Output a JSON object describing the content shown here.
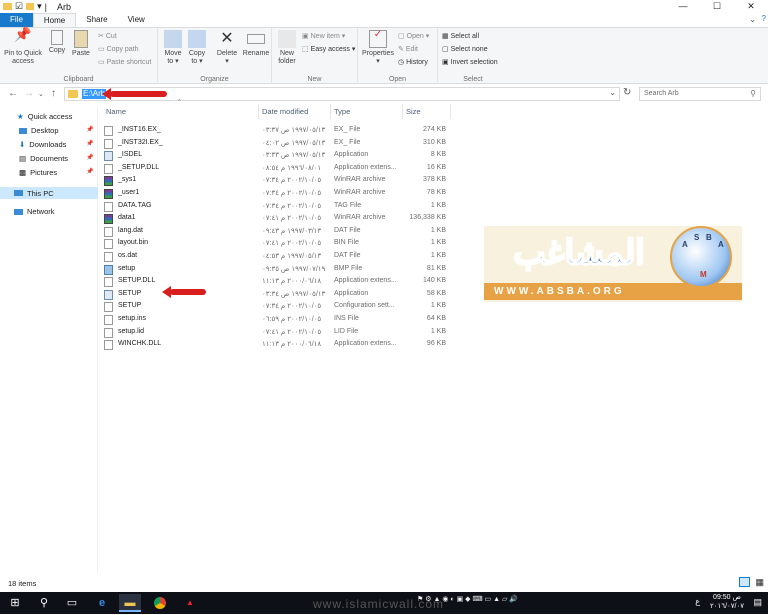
{
  "window": {
    "title": "Arb",
    "controls": {
      "minimize": "—",
      "maximize": "☐",
      "close": "✕"
    }
  },
  "tabs": [
    {
      "label": "File"
    },
    {
      "label": "Home"
    },
    {
      "label": "Share"
    },
    {
      "label": "View"
    }
  ],
  "ribbon": {
    "clipboard": {
      "group_label": "Clipboard",
      "pin_label_1": "Pin to Quick",
      "pin_label_2": "access",
      "copy": "Copy",
      "paste": "Paste",
      "cut": "Cut",
      "copy_path": "Copy path",
      "paste_shortcut": "Paste shortcut"
    },
    "organize": {
      "group_label": "Organize",
      "move_to_1": "Move",
      "move_to_2": "to ▾",
      "copy_to_1": "Copy",
      "copy_to_2": "to ▾",
      "delete_1": "Delete",
      "delete_2": "▾",
      "rename": "Rename"
    },
    "new": {
      "group_label": "New",
      "new_folder_1": "New",
      "new_folder_2": "folder",
      "new_item": "New item ▾",
      "easy_access": "Easy access ▾"
    },
    "open": {
      "group_label": "Open",
      "properties_1": "Properties",
      "properties_2": "▾",
      "open": "Open ▾",
      "edit": "Edit",
      "history": "History"
    },
    "select": {
      "group_label": "Select",
      "select_all": "Select all",
      "select_none": "Select none",
      "invert_selection": "Invert selection"
    }
  },
  "address": {
    "path": "E:\\Arb",
    "search_placeholder": "Search Arb"
  },
  "navpane": {
    "quick_access": "Quick access",
    "desktop": "Desktop",
    "downloads": "Downloads",
    "documents": "Documents",
    "pictures": "Pictures",
    "this_pc": "This PC",
    "network": "Network"
  },
  "columns": {
    "name": "Name",
    "date": "Date modified",
    "type": "Type",
    "size": "Size"
  },
  "files": [
    {
      "name": "_INST16.EX_",
      "date": "١٩٩٧/٠٥/١٣ ص ٠٣:٣٧",
      "type": "EX_ File",
      "size": "274 KB",
      "icon": "file"
    },
    {
      "name": "_INST32I.EX_",
      "date": "١٩٩٧/٠٥/١٣ ص ٠٤:٠٢",
      "type": "EX_ File",
      "size": "310 KB",
      "icon": "file"
    },
    {
      "name": "_ISDEL",
      "date": "١٩٩٧/٠٥/١٣ ص ٠٣:٣٣",
      "type": "Application",
      "size": "8 KB",
      "icon": "app"
    },
    {
      "name": "_SETUP.DLL",
      "date": "١٩٩٦/٠٨/٠١ م ٠٨:٥٤",
      "type": "Application extens...",
      "size": "16 KB",
      "icon": "file"
    },
    {
      "name": "_sys1",
      "date": "٢٠٠٢/١٠/٠٥ م ٠٧:٣٤",
      "type": "WinRAR archive",
      "size": "378 KB",
      "icon": "rar"
    },
    {
      "name": "_user1",
      "date": "٢٠٠٢/١٠/٠٥ م ٠٧:٣٤",
      "type": "WinRAR archive",
      "size": "78 KB",
      "icon": "rar"
    },
    {
      "name": "DATA.TAG",
      "date": "٢٠٠٢/١٠/٠٥ م ٠٧:٣٤",
      "type": "TAG File",
      "size": "1 KB",
      "icon": "file"
    },
    {
      "name": "data1",
      "date": "٢٠٠٢/١٠/٠٥ م ٠٧:٤١",
      "type": "WinRAR archive",
      "size": "136,338 KB",
      "icon": "rar"
    },
    {
      "name": "lang.dat",
      "date": "١٩٩٧/٠٣/١٣ م ٠٩:٤٣",
      "type": "DAT File",
      "size": "1 KB",
      "icon": "file"
    },
    {
      "name": "layout.bin",
      "date": "٢٠٠٢/١٠/٠٥ م ٠٧:٤١",
      "type": "BIN File",
      "size": "1 KB",
      "icon": "file"
    },
    {
      "name": "os.dat",
      "date": "١٩٩٧/٠٥/١٣ م ٠٤:٥٣",
      "type": "DAT File",
      "size": "1 KB",
      "icon": "file"
    },
    {
      "name": "setup",
      "date": "١٩٩٧/٠٧/١٩ ص ٠٩:٣٥",
      "type": "BMP File",
      "size": "81 KB",
      "icon": "bmp"
    },
    {
      "name": "SETUP.DLL",
      "date": "٢٠٠٠/٠٦/١٨ م ١١:١٣",
      "type": "Application extens...",
      "size": "140 KB",
      "icon": "file"
    },
    {
      "name": "SETUP",
      "date": "١٩٩٧/٠٥/١٣ ص ٠٣:٣٤",
      "type": "Application",
      "size": "58 KB",
      "icon": "app"
    },
    {
      "name": "SETUP",
      "date": "٢٠٠٢/١٠/٠٥ م ٠٧:٣٤",
      "type": "Configuration sett...",
      "size": "1 KB",
      "icon": "file"
    },
    {
      "name": "setup.ins",
      "date": "٢٠٠٢/١٠/٠٥ م ٠٦:٥٩",
      "type": "INS File",
      "size": "64 KB",
      "icon": "file"
    },
    {
      "name": "setup.lid",
      "date": "٢٠٠٢/١٠/٠٥ م ٠٧:٤١",
      "type": "LID File",
      "size": "1 KB",
      "icon": "file"
    },
    {
      "name": "WINCHK.DLL",
      "date": "٢٠٠٠/٠٦/١٨ م ١١:١٣",
      "type": "Application extens...",
      "size": "96 KB",
      "icon": "file"
    }
  ],
  "logo": {
    "arabic": "المشاغب",
    "url": "WWW.ABSBA.ORG",
    "ball_letters": [
      "A",
      "S",
      "B",
      "A",
      "M"
    ]
  },
  "status": {
    "item_count": "18 items"
  },
  "taskbar": {
    "watermark": "www.islamicwall.com",
    "clock_time": "09:50 ص",
    "clock_date": "٢٠١٦/٠٧/٠٧",
    "lang": "ع"
  },
  "colors": {
    "accent": "#1979ca",
    "annotation_arrow": "#d81e1e",
    "selection": "#3399ff"
  }
}
